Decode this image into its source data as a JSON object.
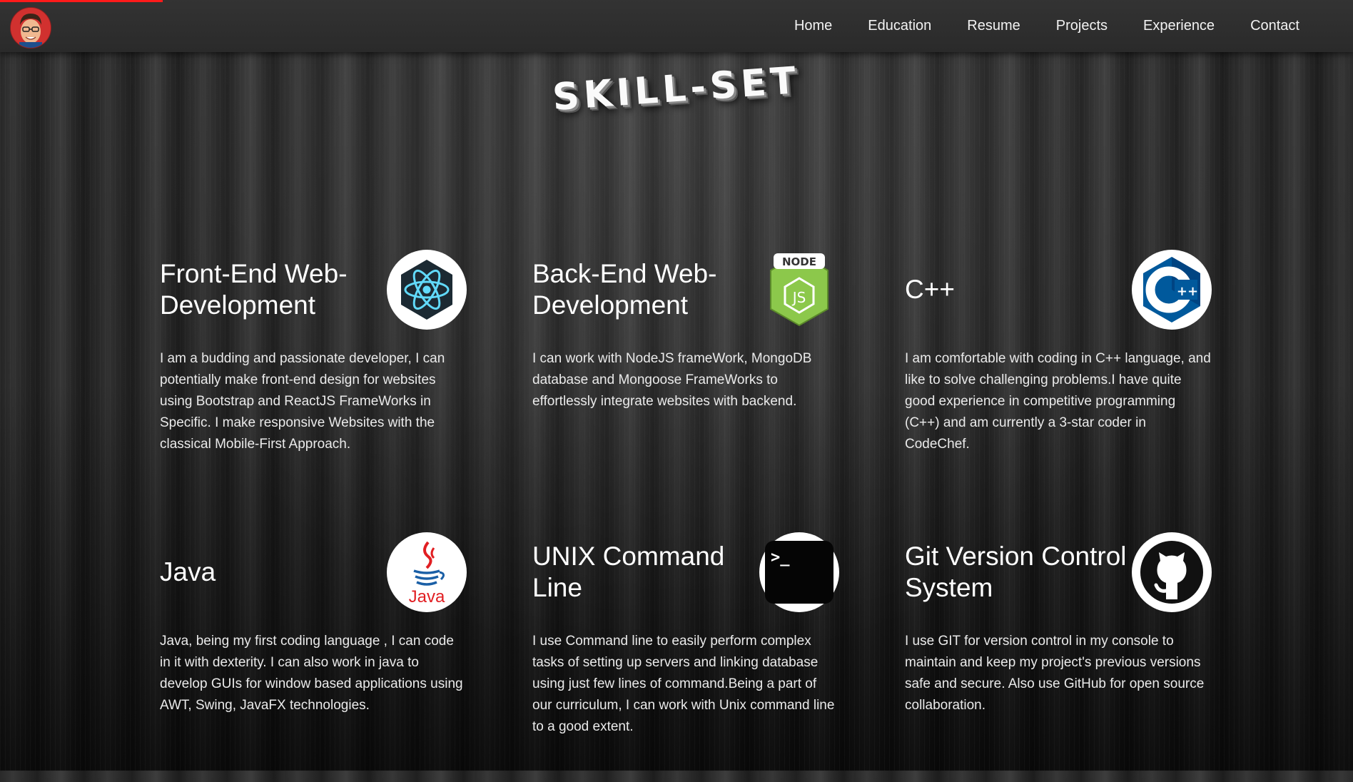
{
  "progress_fraction": 0.12,
  "nav": {
    "items": [
      {
        "label": "Home"
      },
      {
        "label": "Education"
      },
      {
        "label": "Resume"
      },
      {
        "label": "Projects"
      },
      {
        "label": "Experience"
      },
      {
        "label": "Contact"
      }
    ]
  },
  "section": {
    "title": "SKILL-SET"
  },
  "skills": [
    {
      "title": "Front-End Web-Development",
      "icon": "react-icon",
      "desc": "I am a budding and passionate developer, I can potentially make front-end design for websites using Bootstrap and ReactJS FrameWorks in Specific. I make responsive Websites with the classical Mobile-First Approach."
    },
    {
      "title": "Back-End Web-Development",
      "icon": "nodejs-icon",
      "desc": "I can work with NodeJS frameWork, MongoDB database and Mongoose FrameWorks to effortlessly integrate websites with backend."
    },
    {
      "title": "C++",
      "icon": "cpp-icon",
      "desc": "I am comfortable with coding in C++ language, and like to solve challenging problems.I have quite good experience in competitive programming (C++) and am currently a 3-star coder in CodeChef."
    },
    {
      "title": "Java",
      "icon": "java-icon",
      "desc": "Java, being my first coding language , I can code in it with dexterity. I can also work in java to develop GUIs for window based applications using AWT, Swing, JavaFX technologies."
    },
    {
      "title": "UNIX Command Line",
      "icon": "terminal-icon",
      "desc": "I use Command line to easily perform complex tasks of setting up servers and linking database using just few lines of command.Being a part of our curriculum, I can work with Unix command line to a good extent."
    },
    {
      "title": "Git Version Control System",
      "icon": "github-icon",
      "desc": "I use GIT for version control in my console to maintain and keep my project's previous versions safe and secure. Also use GitHub for open source collaboration."
    }
  ],
  "icon_logos": {
    "nodejs": "NODE",
    "nodejs_js": "JS",
    "cpp": "C",
    "cpp_plus": "++",
    "java": "Java",
    "terminal": ">_"
  },
  "colors": {
    "accent": "#ff1a1a",
    "react": "#61dafb",
    "node": "#8cc84b",
    "cpp": "#00599c",
    "java_red": "#e11e22",
    "java_blue": "#1a5fa6"
  }
}
